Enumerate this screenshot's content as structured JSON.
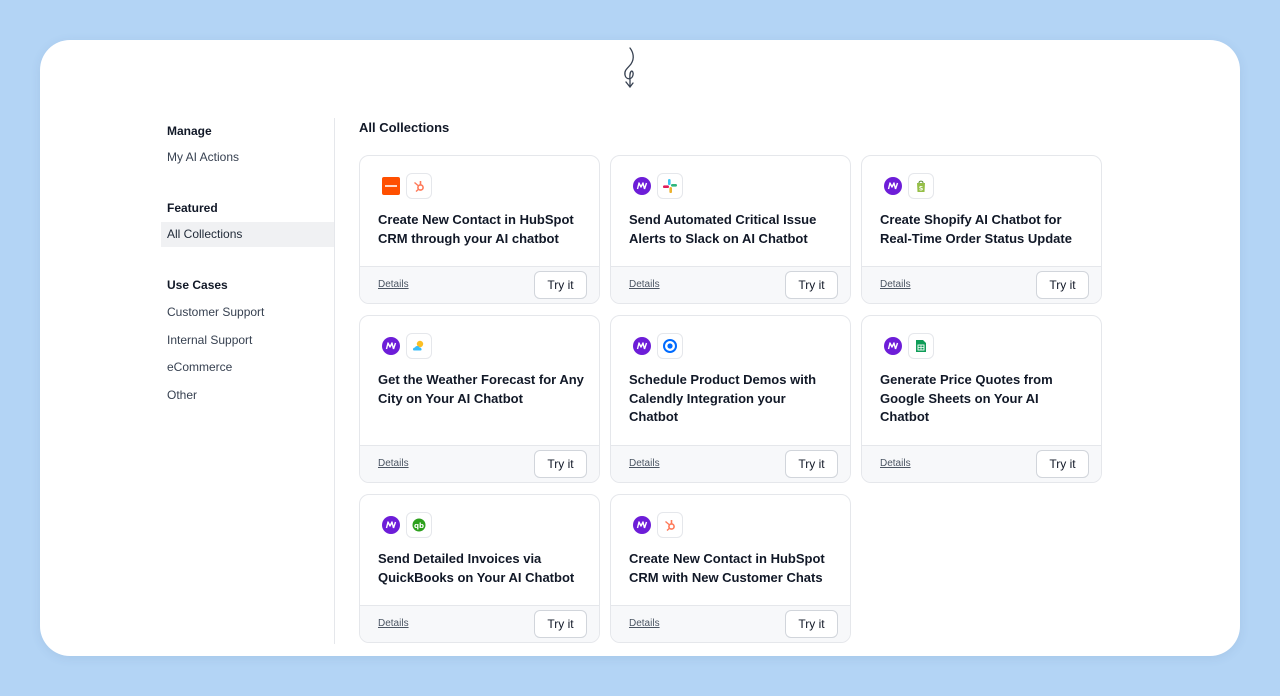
{
  "sidebar": {
    "manage_heading": "Manage",
    "manage_items": [
      {
        "label": "My AI Actions"
      }
    ],
    "featured_heading": "Featured",
    "featured_items": [
      {
        "label": "All Collections",
        "active": true
      }
    ],
    "usecases_heading": "Use Cases",
    "usecase_items": [
      {
        "label": "Customer Support"
      },
      {
        "label": "Internal Support"
      },
      {
        "label": "eCommerce"
      },
      {
        "label": "Other"
      }
    ]
  },
  "main": {
    "title": "All Collections",
    "cards": [
      {
        "title": "Create New Contact in HubSpot CRM through your AI chatbot",
        "icons": [
          "zapier-icon",
          "hubspot-icon"
        ],
        "details_label": "Details",
        "try_label": "Try it"
      },
      {
        "title": "Send Automated Critical Issue Alerts to Slack on AI Chatbot",
        "icons": [
          "make-icon",
          "slack-icon"
        ],
        "details_label": "Details",
        "try_label": "Try it"
      },
      {
        "title": "Create Shopify AI Chatbot for Real-Time Order Status Update",
        "icons": [
          "make-icon",
          "shopify-icon"
        ],
        "details_label": "Details",
        "try_label": "Try it"
      },
      {
        "title": "Get the Weather Forecast for Any City on Your AI Chatbot",
        "icons": [
          "make-icon",
          "weather-icon"
        ],
        "details_label": "Details",
        "try_label": "Try it"
      },
      {
        "title": "Schedule Product Demos with Calendly Integration your Chatbot",
        "icons": [
          "make-icon",
          "calendly-icon"
        ],
        "details_label": "Details",
        "try_label": "Try it"
      },
      {
        "title": "Generate Price Quotes from Google Sheets on Your AI Chatbot",
        "icons": [
          "make-icon",
          "google-sheets-icon"
        ],
        "details_label": "Details",
        "try_label": "Try it"
      },
      {
        "title": "Send Detailed Invoices via QuickBooks on Your AI Chatbot",
        "icons": [
          "make-icon",
          "quickbooks-icon"
        ],
        "details_label": "Details",
        "try_label": "Try it"
      },
      {
        "title": "Create New Contact in HubSpot CRM with New Customer Chats",
        "icons": [
          "make-icon",
          "hubspot-icon"
        ],
        "details_label": "Details",
        "try_label": "Try it"
      }
    ]
  },
  "colors": {
    "background": "#b3d4f5",
    "make_purple": "#6d1dd8",
    "zapier_orange": "#ff4f00",
    "hubspot_orange": "#ff7a59"
  }
}
